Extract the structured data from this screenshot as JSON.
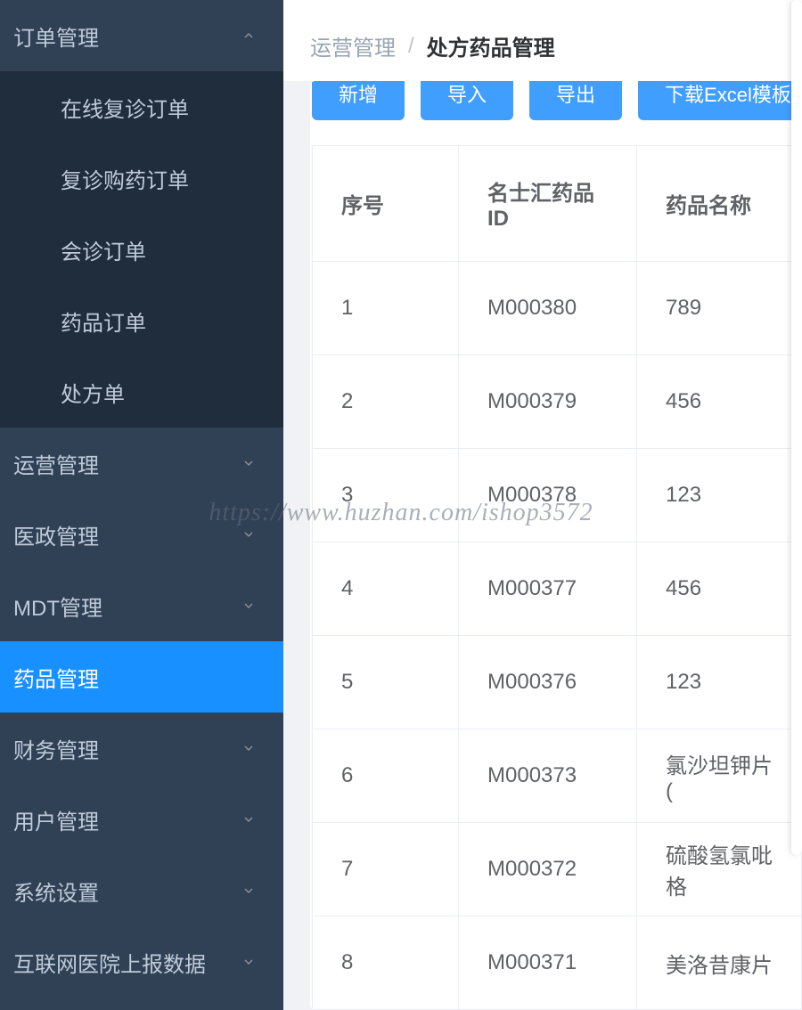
{
  "sidebar": {
    "groups": [
      {
        "label": "订单管理",
        "expanded": true,
        "active": false,
        "children": [
          {
            "label": "在线复诊订单"
          },
          {
            "label": "复诊购药订单"
          },
          {
            "label": "会诊订单"
          },
          {
            "label": "药品订单"
          },
          {
            "label": "处方单"
          }
        ]
      },
      {
        "label": "运营管理",
        "expanded": false,
        "active": false
      },
      {
        "label": "医政管理",
        "expanded": false,
        "active": false
      },
      {
        "label": "MDT管理",
        "expanded": false,
        "active": false
      },
      {
        "label": "药品管理",
        "expanded": false,
        "active": true
      },
      {
        "label": "财务管理",
        "expanded": false,
        "active": false
      },
      {
        "label": "用户管理",
        "expanded": false,
        "active": false
      },
      {
        "label": "系统设置",
        "expanded": false,
        "active": false
      },
      {
        "label": "互联网医院上报数据",
        "expanded": false,
        "active": false
      }
    ]
  },
  "breadcrumb": {
    "parent": "运营管理",
    "sep": "/",
    "current": "处方药品管理"
  },
  "toolbar": {
    "add": "新增",
    "import": "导入",
    "export": "导出",
    "download_template": "下载Excel模板"
  },
  "table": {
    "headers": {
      "idx": "序号",
      "med_id": "名士汇药品ID",
      "name": "药品名称"
    },
    "rows": [
      {
        "idx": "1",
        "med_id": "M000380",
        "name": "789"
      },
      {
        "idx": "2",
        "med_id": "M000379",
        "name": "456"
      },
      {
        "idx": "3",
        "med_id": "M000378",
        "name": "123"
      },
      {
        "idx": "4",
        "med_id": "M000377",
        "name": "456"
      },
      {
        "idx": "5",
        "med_id": "M000376",
        "name": "123"
      },
      {
        "idx": "6",
        "med_id": "M000373",
        "name": "氯沙坦钾片("
      },
      {
        "idx": "7",
        "med_id": "M000372",
        "name": "硫酸氢氯吡格"
      },
      {
        "idx": "8",
        "med_id": "M000371",
        "name": "美洛昔康片"
      }
    ]
  },
  "watermark": "https://www.huzhan.com/ishop3572"
}
